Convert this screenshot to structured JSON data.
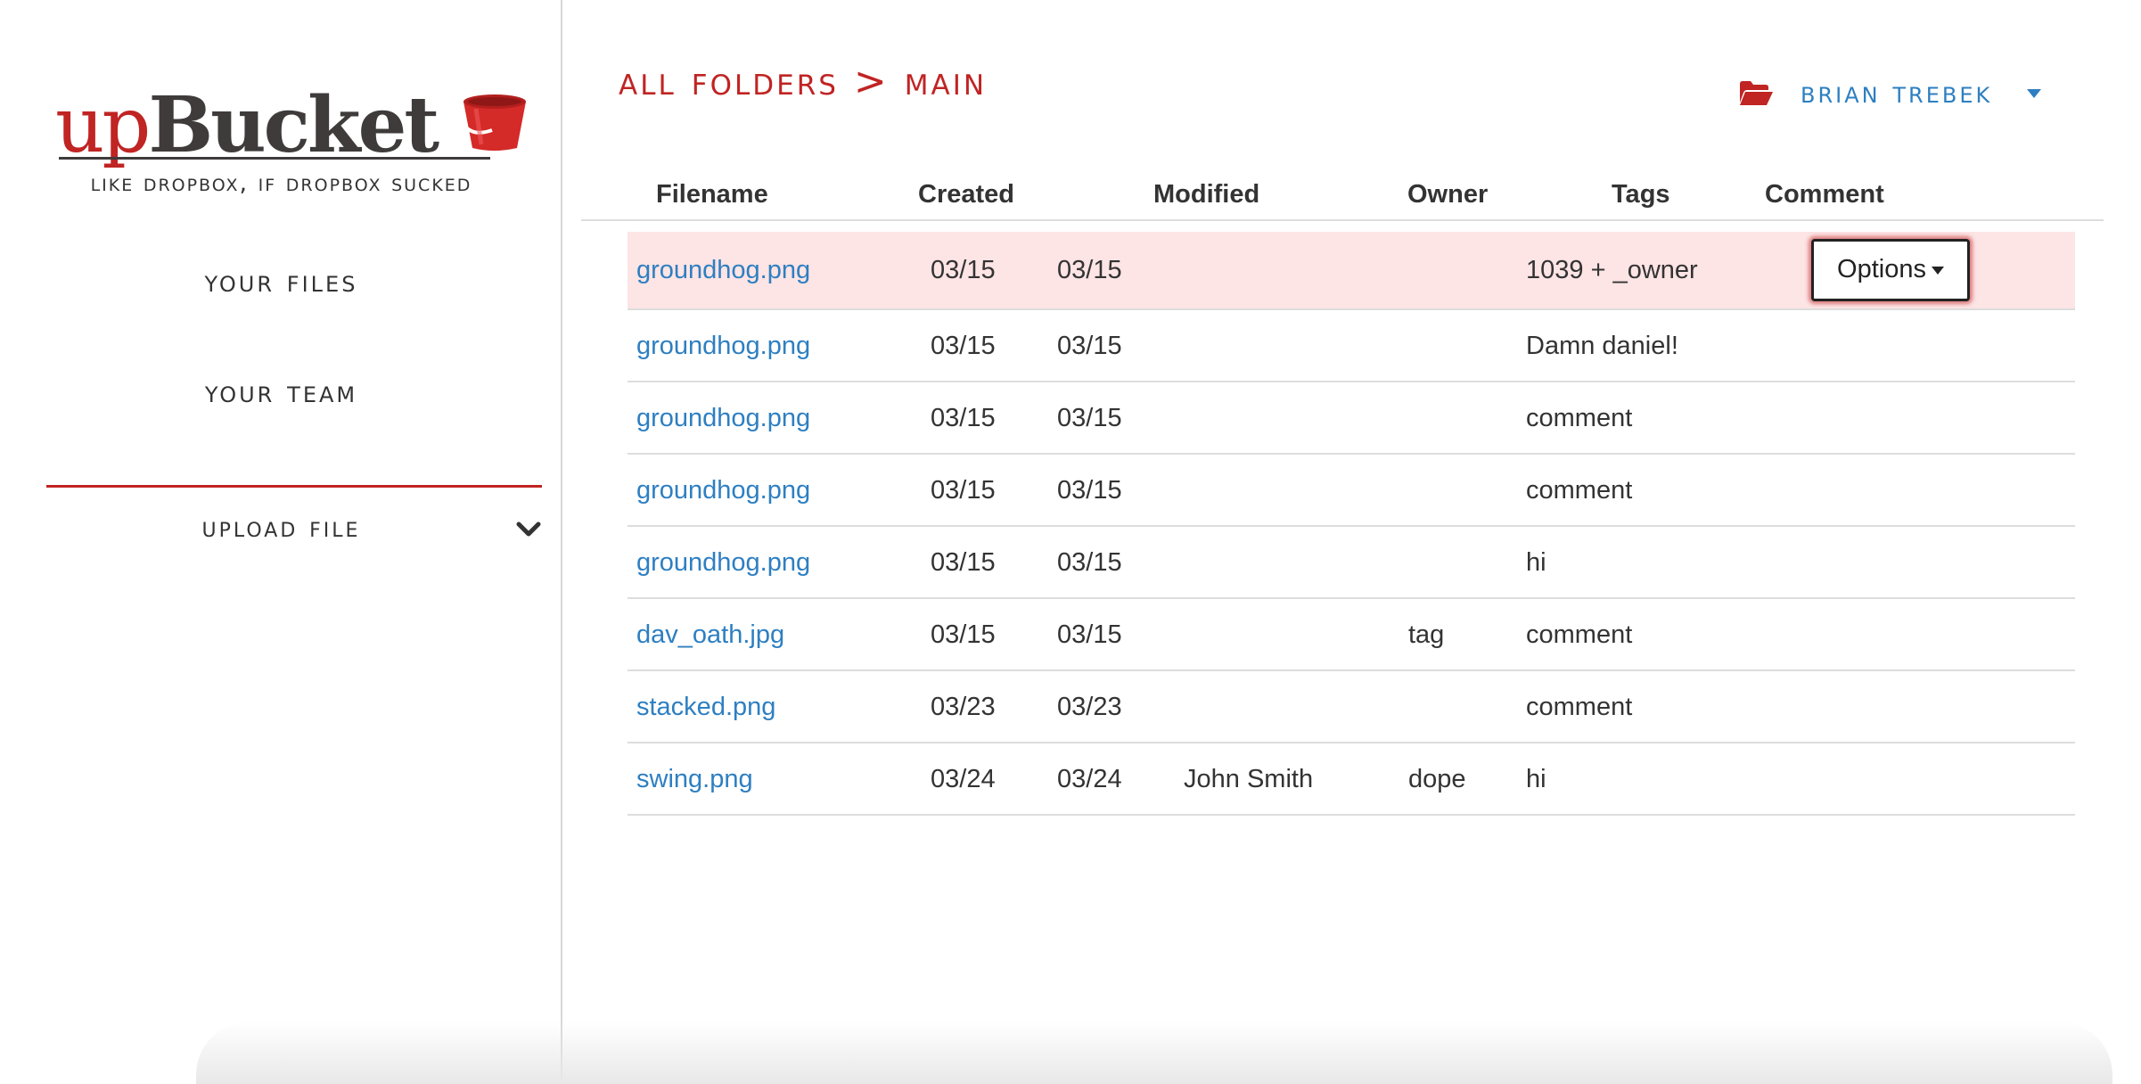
{
  "brand": {
    "logo_up": "up",
    "logo_bucket": "Bucket",
    "tagline": "Like Dropbox, if Dropbox sucked",
    "accent_color": "#c02423",
    "link_color": "#2e7fc1"
  },
  "sidebar": {
    "nav": [
      {
        "label": "Your Files",
        "icon": ""
      },
      {
        "label": "Your Team",
        "icon": ""
      }
    ],
    "upload": {
      "label": "Upload File",
      "icon": "chevron-down-icon"
    }
  },
  "header": {
    "breadcrumb": {
      "root": "All Folders",
      "separator": ">",
      "current": "main"
    },
    "user": {
      "name": "Brian Trebek",
      "icon": "folder-open-icon"
    }
  },
  "table": {
    "columns": [
      "Filename",
      "Created",
      "Modified",
      "Owner",
      "Tags",
      "Comment"
    ],
    "rows": [
      {
        "filename": "groundhog.png",
        "created": "03/15",
        "modified": "03/15",
        "owner": "",
        "tags": "",
        "comment": "1039 + _owner",
        "selected": true,
        "action": "Options"
      },
      {
        "filename": "groundhog.png",
        "created": "03/15",
        "modified": "03/15",
        "owner": "",
        "tags": "",
        "comment": "Damn daniel!"
      },
      {
        "filename": "groundhog.png",
        "created": "03/15",
        "modified": "03/15",
        "owner": "",
        "tags": "",
        "comment": "comment"
      },
      {
        "filename": "groundhog.png",
        "created": "03/15",
        "modified": "03/15",
        "owner": "",
        "tags": "",
        "comment": "comment"
      },
      {
        "filename": "groundhog.png",
        "created": "03/15",
        "modified": "03/15",
        "owner": "",
        "tags": "",
        "comment": "hi"
      },
      {
        "filename": "dav_oath.jpg",
        "created": "03/15",
        "modified": "03/15",
        "owner": "",
        "tags": "tag",
        "comment": "comment"
      },
      {
        "filename": "stacked.png",
        "created": "03/23",
        "modified": "03/23",
        "owner": "",
        "tags": "",
        "comment": "comment"
      },
      {
        "filename": "swing.png",
        "created": "03/24",
        "modified": "03/24",
        "owner": "John Smith",
        "tags": "dope",
        "comment": "hi"
      }
    ]
  }
}
